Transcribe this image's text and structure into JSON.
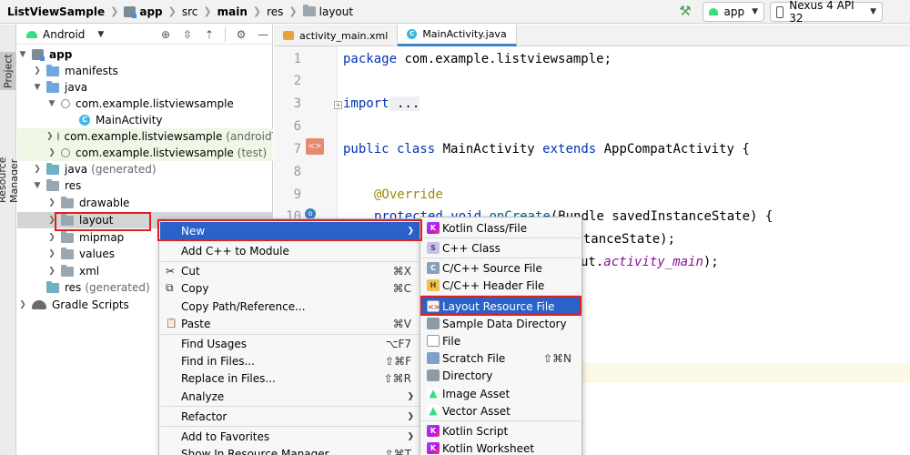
{
  "breadcrumb": [
    "ListViewSample",
    "app",
    "src",
    "main",
    "res",
    "layout"
  ],
  "toolbar": {
    "config": "app",
    "device": "Nexus 4 API 32"
  },
  "stripe": {
    "project": "Project",
    "resource_manager": "Resource Manager"
  },
  "panel": {
    "view_mode": "Android"
  },
  "tree": [
    {
      "label": "app",
      "suffix": ""
    },
    {
      "label": "manifests",
      "suffix": ""
    },
    {
      "label": "java",
      "suffix": ""
    },
    {
      "label": "com.example.listviewsample",
      "suffix": ""
    },
    {
      "label": "MainActivity",
      "suffix": ""
    },
    {
      "label": "com.example.listviewsample",
      "suffix": "(androidTest)"
    },
    {
      "label": "com.example.listviewsample",
      "suffix": "(test)"
    },
    {
      "label": "java",
      "suffix": "(generated)"
    },
    {
      "label": "res",
      "suffix": ""
    },
    {
      "label": "drawable",
      "suffix": ""
    },
    {
      "label": "layout",
      "suffix": ""
    },
    {
      "label": "mipmap",
      "suffix": ""
    },
    {
      "label": "values",
      "suffix": ""
    },
    {
      "label": "xml",
      "suffix": ""
    },
    {
      "label": "res",
      "suffix": "(generated)"
    },
    {
      "label": "Gradle Scripts",
      "suffix": ""
    }
  ],
  "tabs": [
    "activity_main.xml",
    "MainActivity.java"
  ],
  "line_numbers": [
    "1",
    "2",
    "3",
    "6",
    "7",
    "8",
    "9",
    "10"
  ],
  "code": {
    "l1_kw": "package",
    "l1_rest": " com.example.listviewsample;",
    "l3_kw": "import",
    "l3_rest": " ...",
    "l7_kw": "public class",
    "l7_mid": " MainActivity ",
    "l7_kw2": "extends",
    "l7_rest": " AppCompatActivity {",
    "l9_ann": "@Override",
    "l10_kw": "protected void",
    "l10_mid": " onCreate",
    "l10_rest": "(Bundle savedInstanceState) {",
    "l11": "nstanceState);",
    "l12_a": "ut.",
    "l12_it": "activity_main",
    "l12_b": ");"
  },
  "context_menu": [
    {
      "label": "New",
      "shortcut": "",
      "submenu": true
    },
    {
      "label": "Add C++ to Module",
      "shortcut": ""
    },
    {
      "label": "Cut",
      "shortcut": "⌘X",
      "icon": "✂"
    },
    {
      "label": "Copy",
      "shortcut": "⌘C",
      "icon": "⧉"
    },
    {
      "label": "Copy Path/Reference...",
      "shortcut": ""
    },
    {
      "label": "Paste",
      "shortcut": "⌘V",
      "icon": "📋"
    },
    {
      "label": "Find Usages",
      "shortcut": "⌥F7"
    },
    {
      "label": "Find in Files...",
      "shortcut": "⇧⌘F"
    },
    {
      "label": "Replace in Files...",
      "shortcut": "⇧⌘R"
    },
    {
      "label": "Analyze",
      "shortcut": "",
      "submenu": true
    },
    {
      "label": "Refactor",
      "shortcut": "",
      "submenu": true
    },
    {
      "label": "Add to Favorites",
      "shortcut": "",
      "submenu": true
    },
    {
      "label": "Show In Resource Manager",
      "shortcut": "⇧⌘T"
    }
  ],
  "new_submenu": [
    {
      "label": "Kotlin Class/File",
      "icon": "K",
      "shortcut": ""
    },
    {
      "label": "C++ Class",
      "icon": "S",
      "shortcut": ""
    },
    {
      "label": "C/C++ Source File",
      "icon": "C",
      "shortcut": ""
    },
    {
      "label": "C/C++ Header File",
      "icon": "H",
      "shortcut": ""
    },
    {
      "label": "Layout Resource File",
      "icon": "<>",
      "shortcut": ""
    },
    {
      "label": "Sample Data Directory",
      "icon": "",
      "shortcut": ""
    },
    {
      "label": "File",
      "icon": "",
      "shortcut": ""
    },
    {
      "label": "Scratch File",
      "icon": "",
      "shortcut": "⇧⌘N"
    },
    {
      "label": "Directory",
      "icon": "",
      "shortcut": ""
    },
    {
      "label": "Image Asset",
      "icon": "▲",
      "shortcut": ""
    },
    {
      "label": "Vector Asset",
      "icon": "▲",
      "shortcut": ""
    },
    {
      "label": "Kotlin Script",
      "icon": "K",
      "shortcut": ""
    },
    {
      "label": "Kotlin Worksheet",
      "icon": "K",
      "shortcut": ""
    }
  ],
  "colors": {
    "accent": "#2a62c9",
    "highlight_box": "#e02020",
    "keyword": "#0033b3",
    "annotation": "#9e880d"
  }
}
